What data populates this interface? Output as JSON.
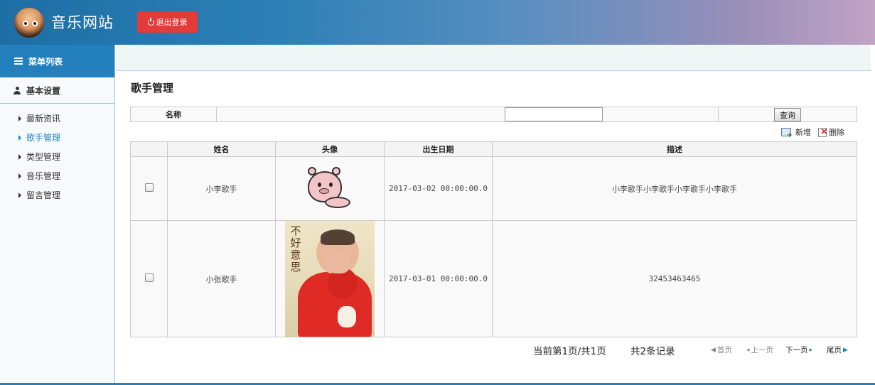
{
  "header": {
    "site_title": "音乐网站",
    "logout_label": "退出登录",
    "gradient_start": "#1d6fa6",
    "gradient_end": "#c2a3c6",
    "logout_color": "#e33a3a"
  },
  "sidebar": {
    "menu_title": "菜单列表",
    "group_title": "基本设置",
    "items": [
      {
        "label": "最新资讯",
        "active": false
      },
      {
        "label": "歌手管理",
        "active": true
      },
      {
        "label": "类型管理",
        "active": false
      },
      {
        "label": "音乐管理",
        "active": false
      },
      {
        "label": "留言管理",
        "active": false
      }
    ],
    "accent": "#2380bd"
  },
  "main": {
    "page_title": "歌手管理",
    "search": {
      "label": "名称",
      "value": "",
      "query_label": "查询"
    },
    "actions": {
      "add_label": "新增",
      "delete_label": "删除"
    },
    "table": {
      "headers": [
        "",
        "姓名",
        "头像",
        "出生日期",
        "描述"
      ],
      "rows": [
        {
          "checked": false,
          "name": "小李歌手",
          "avatar_icon": "cartoon-pig-image",
          "birth": "2017-03-02 00:00:00.0",
          "desc": "小李歌手小李歌手小李歌手小李歌手"
        },
        {
          "checked": false,
          "name": "小张歌手",
          "avatar_icon": "baby-photo-image",
          "avatar_caption": "不好意思",
          "birth": "2017-03-01 00:00:00.0",
          "desc": "32453463465"
        }
      ]
    },
    "pager": {
      "page_info": "当前第1页/共1页",
      "record_info": "共2条记录",
      "first": "首页",
      "prev": "上一页",
      "next": "下一页",
      "last": "尾页"
    }
  }
}
